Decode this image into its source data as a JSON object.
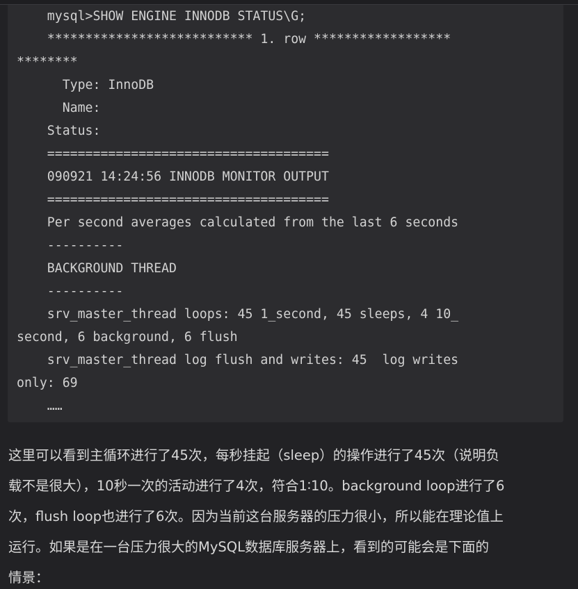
{
  "code_block": {
    "lines": [
      "    mysql>SHOW ENGINE INNODB STATUS\\G;",
      "    *************************** 1. row ******************",
      "********",
      "      Type: InnoDB",
      "      Name:",
      "    Status:",
      "    =====================================",
      "    090921 14:24:56 INNODB MONITOR OUTPUT",
      "    =====================================",
      "    Per second averages calculated from the last 6 seconds",
      "    ----------",
      "    BACKGROUND THREAD",
      "    ----------",
      "    srv_master_thread loops: 45 1_second, 45 sleeps, 4 10_",
      "second, 6 background, 6 flush",
      "    srv_master_thread log flush and writes: 45  log writes",
      "only: 69",
      "    ……"
    ]
  },
  "paragraph": {
    "lines": [
      "这里可以看到主循环进行了45次，每秒挂起（sleep）的操作进行了45次（说明负",
      "载不是很大），10秒一次的活动进行了4次，符合1∶10。background loop进行了6",
      "次，flush loop也进行了6次。因为当前这台服务器的压力很小，所以能在理论值上",
      "运行。如果是在一台压力很大的MySQL数据库服务器上，看到的可能会是下面的",
      "情景："
    ]
  }
}
